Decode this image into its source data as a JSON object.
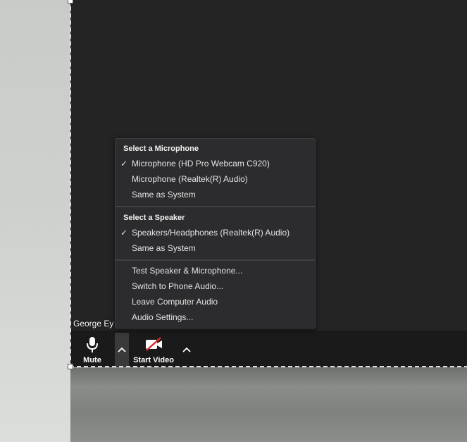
{
  "participant": {
    "name": "George Ey"
  },
  "audio_menu": {
    "mic_section_title": "Select a Microphone",
    "microphones": [
      {
        "label": "Microphone (HD Pro Webcam C920)",
        "checked": "✓"
      },
      {
        "label": "Microphone (Realtek(R) Audio)",
        "checked": ""
      },
      {
        "label": "Same as System",
        "checked": ""
      }
    ],
    "speaker_section_title": "Select a Speaker",
    "speakers": [
      {
        "label": "Speakers/Headphones (Realtek(R) Audio)",
        "checked": "✓"
      },
      {
        "label": "Same as System",
        "checked": ""
      }
    ],
    "actions": [
      {
        "label": "Test Speaker & Microphone..."
      },
      {
        "label": "Switch to Phone Audio..."
      },
      {
        "label": "Leave Computer Audio"
      },
      {
        "label": "Audio Settings..."
      }
    ]
  },
  "toolbar": {
    "mute_label": "Mute",
    "start_video_label": "Start Video"
  },
  "icons": {
    "mute": "microphone-icon",
    "video": "video-camera-off-icon",
    "caret": "chevron-up-icon"
  },
  "colors": {
    "menu_bg": "#2c2c2e",
    "window_bg": "#242424",
    "toolbar_bg": "#1a1a1a",
    "video_off_red": "#e02828"
  }
}
